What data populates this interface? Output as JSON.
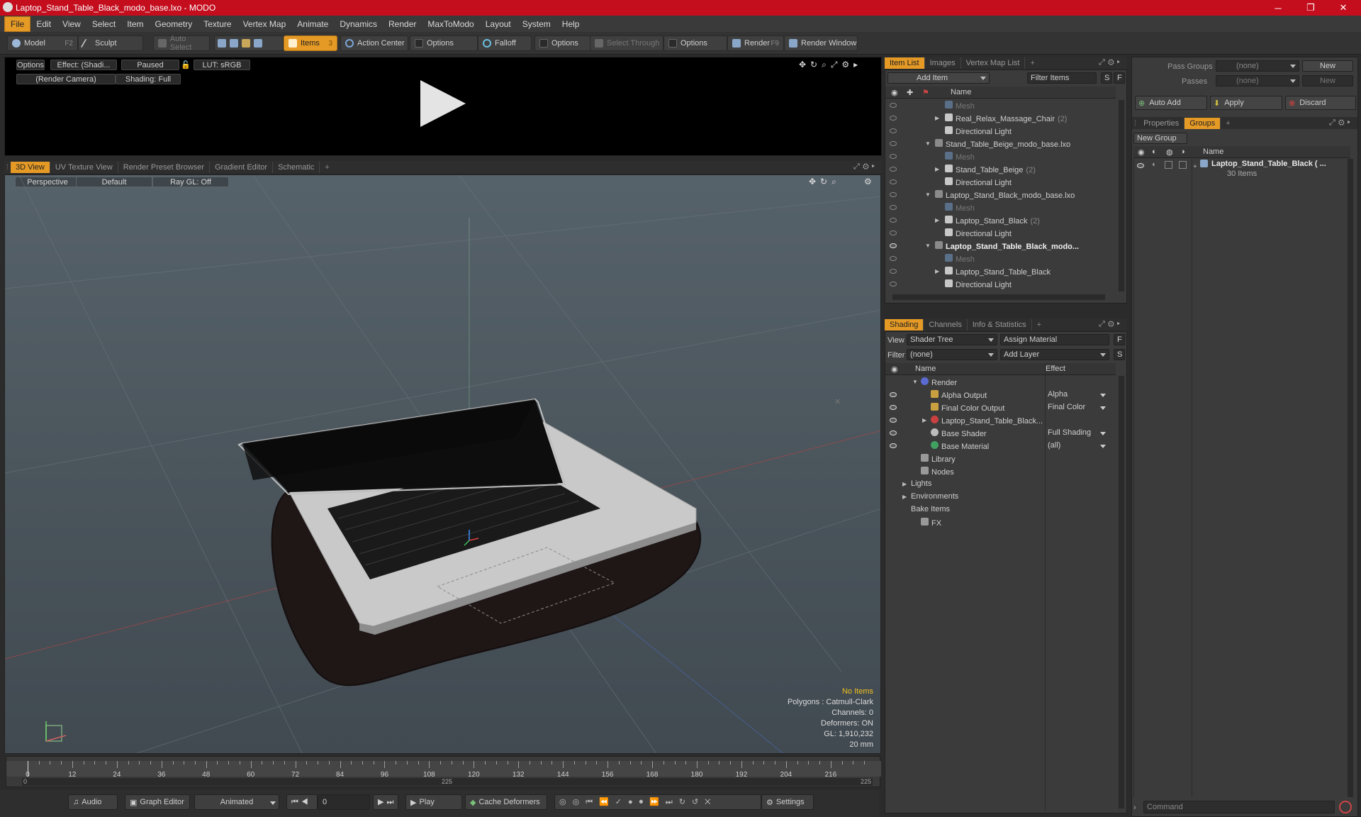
{
  "window": {
    "title": "Laptop_Stand_Table_Black_modo_base.lxo - MODO",
    "minimize": "─",
    "restore": "❐",
    "close": "✕"
  },
  "menu": [
    "File",
    "Edit",
    "View",
    "Select",
    "Item",
    "Geometry",
    "Texture",
    "Vertex Map",
    "Animate",
    "Dynamics",
    "Render",
    "MaxToModo",
    "Layout",
    "System",
    "Help"
  ],
  "toolbar": {
    "model": "Model",
    "model_key": "F2",
    "sculpt": "Sculpt",
    "auto_select": "Auto Select",
    "items": "Items",
    "items_key": "3",
    "action_center": "Action Center",
    "options1": "Options",
    "falloff": "Falloff",
    "options2": "Options",
    "select_through": "Select Through",
    "options3": "Options",
    "render": "Render",
    "render_key": "F9",
    "render_window": "Render Window"
  },
  "preview": {
    "options": "Options",
    "effect": "Effect: (Shadi...",
    "paused": "Paused",
    "lut": "LUT: sRGB",
    "camera": "(Render Camera)",
    "shading": "Shading: Full"
  },
  "view_tabs": [
    "3D View",
    "UV Texture View",
    "Render Preset Browser",
    "Gradient Editor",
    "Schematic",
    "+"
  ],
  "viewport": {
    "perspective": "Perspective",
    "default": "Default",
    "raygl": "Ray GL: Off",
    "stats": {
      "no_items": "No Items",
      "polygons": "Polygons : Catmull-Clark",
      "channels": "Channels: 0",
      "deformers": "Deformers: ON",
      "gl": "GL: 1,910,232",
      "scale": "20 mm"
    }
  },
  "timeline": {
    "labels": [
      "0",
      "12",
      "24",
      "36",
      "48",
      "60",
      "72",
      "84",
      "96",
      "108",
      "120",
      "132",
      "144",
      "156",
      "168",
      "180",
      "192",
      "204",
      "216"
    ],
    "start": "0",
    "mid": "225",
    "end": "225"
  },
  "bottombar": {
    "audio": "Audio",
    "graph_editor": "Graph Editor",
    "animated": "Animated",
    "frame": "0",
    "play": "Play",
    "cache_deformers": "Cache Deformers",
    "settings": "Settings"
  },
  "item_list": {
    "tabs": [
      "Item List",
      "Images",
      "Vertex Map List",
      "+"
    ],
    "add_item": "Add Item",
    "filter_items": "Filter Items",
    "s": "S",
    "f": "F",
    "col_name": "Name",
    "rows": [
      {
        "label": "Mesh",
        "indent": 3,
        "muted": true,
        "arrow": "",
        "count": ""
      },
      {
        "label": "Real_Relax_Massage_Chair",
        "indent": 3,
        "muted": false,
        "arrow": "▶",
        "count": "(2)"
      },
      {
        "label": "Directional Light",
        "indent": 3,
        "muted": false,
        "arrow": "",
        "count": ""
      },
      {
        "label": "Stand_Table_Beige_modo_base.lxo",
        "indent": 2,
        "muted": false,
        "arrow": "▼",
        "count": ""
      },
      {
        "label": "Mesh",
        "indent": 3,
        "muted": true,
        "arrow": "",
        "count": ""
      },
      {
        "label": "Stand_Table_Beige",
        "indent": 3,
        "muted": false,
        "arrow": "▶",
        "count": "(2)"
      },
      {
        "label": "Directional Light",
        "indent": 3,
        "muted": false,
        "arrow": "",
        "count": ""
      },
      {
        "label": "Laptop_Stand_Black_modo_base.lxo",
        "indent": 2,
        "muted": false,
        "arrow": "▼",
        "count": ""
      },
      {
        "label": "Mesh",
        "indent": 3,
        "muted": true,
        "arrow": "",
        "count": ""
      },
      {
        "label": "Laptop_Stand_Black",
        "indent": 3,
        "muted": false,
        "arrow": "▶",
        "count": "(2)"
      },
      {
        "label": "Directional Light",
        "indent": 3,
        "muted": false,
        "arrow": "",
        "count": ""
      },
      {
        "label": "Laptop_Stand_Table_Black_modo...",
        "indent": 2,
        "muted": false,
        "arrow": "▼",
        "count": "",
        "bold": true
      },
      {
        "label": "Mesh",
        "indent": 3,
        "muted": true,
        "arrow": "",
        "count": ""
      },
      {
        "label": "Laptop_Stand_Table_Black",
        "indent": 3,
        "muted": false,
        "arrow": "▶",
        "count": ""
      },
      {
        "label": "Directional Light",
        "indent": 3,
        "muted": false,
        "arrow": "",
        "count": ""
      }
    ]
  },
  "shading": {
    "tabs": [
      "Shading",
      "Channels",
      "Info & Statistics",
      "+"
    ],
    "view_label": "View",
    "view_value": "Shader Tree",
    "assign_material": "Assign Material",
    "f": "F",
    "filter_label": "Filter",
    "filter_value": "(none)",
    "add_layer": "Add Layer",
    "s": "S",
    "col_name": "Name",
    "col_effect": "Effect",
    "rows": [
      {
        "label": "Render",
        "effect": "",
        "indent": 1,
        "arrow": "▼",
        "color": "#5a6ad0"
      },
      {
        "label": "Alpha Output",
        "effect": "Alpha",
        "indent": 2,
        "arrow": "",
        "color": "#c9a040"
      },
      {
        "label": "Final Color Output",
        "effect": "Final Color",
        "indent": 2,
        "arrow": "",
        "color": "#c9a040"
      },
      {
        "label": "Laptop_Stand_Table_Black...",
        "effect": "",
        "indent": 2,
        "arrow": "▶",
        "color": "#c94040"
      },
      {
        "label": "Base Shader",
        "effect": "Full Shading",
        "indent": 2,
        "arrow": "",
        "color": "#bbbbbb"
      },
      {
        "label": "Base Material",
        "effect": "(all)",
        "indent": 2,
        "arrow": "",
        "color": "#40a060"
      },
      {
        "label": "Library",
        "effect": "",
        "indent": 1,
        "arrow": "",
        "color": "#999999"
      },
      {
        "label": "Nodes",
        "effect": "",
        "indent": 1,
        "arrow": "",
        "color": "#999999"
      },
      {
        "label": "Lights",
        "effect": "",
        "indent": 0,
        "arrow": "▶",
        "color": ""
      },
      {
        "label": "Environments",
        "effect": "",
        "indent": 0,
        "arrow": "▶",
        "color": ""
      },
      {
        "label": "Bake Items",
        "effect": "",
        "indent": 0,
        "arrow": "",
        "color": ""
      },
      {
        "label": "FX",
        "effect": "",
        "indent": 1,
        "arrow": "",
        "color": "#999999"
      }
    ]
  },
  "groups": {
    "pass_groups_label": "Pass Groups",
    "pass_groups_value": "(none)",
    "new": "New",
    "passes_label": "Passes",
    "passes_value": "(none)",
    "new2": "New",
    "auto_add": "Auto Add",
    "apply": "Apply",
    "discard": "Discard",
    "tabs": [
      "Properties",
      "Groups",
      "+"
    ],
    "new_group": "New Group",
    "col_name": "Name",
    "group_name": "Laptop_Stand_Table_Black ( ...",
    "group_count": "30 Items",
    "command_placeholder": "Command"
  },
  "colors": {
    "accent": "#e59a26",
    "titlebar": "#c40d1d"
  }
}
